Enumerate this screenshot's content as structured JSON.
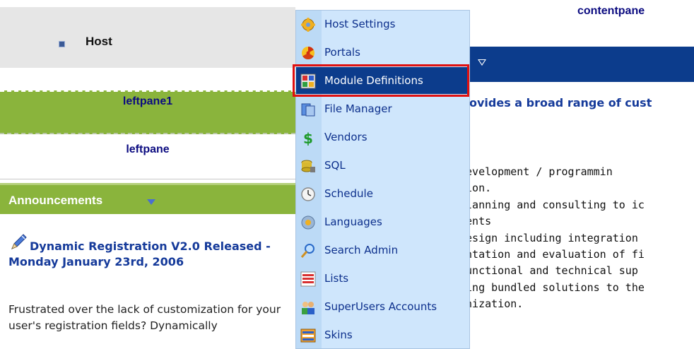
{
  "left": {
    "host_label": "Host",
    "leftpane1_label": "leftpane1",
    "leftpane_label": "leftpane",
    "announcements_title": "Announcements",
    "article_title": "Dynamic Registration V2.0 Released - Monday January 23rd, 2006",
    "article_body": "Frustrated over the lack of customization for your user's registration fields? Dynamically"
  },
  "content": {
    "pane_label": "contentpane",
    "heading": "ovides a broad range of cust",
    "lines": [
      "development / programmin",
      "tion.",
      "planning and consulting to ic",
      "nents",
      " design including integration",
      "entation and evaluation of fi",
      "functional and technical sup",
      "zing bundled solutions to the",
      "anization."
    ]
  },
  "menu": {
    "items": [
      {
        "label": "Host Settings",
        "icon": "host-settings-icon"
      },
      {
        "label": "Portals",
        "icon": "portals-icon"
      },
      {
        "label": "Module Definitions",
        "icon": "module-definitions-icon"
      },
      {
        "label": "File Manager",
        "icon": "file-manager-icon"
      },
      {
        "label": "Vendors",
        "icon": "vendors-icon"
      },
      {
        "label": "SQL",
        "icon": "sql-icon"
      },
      {
        "label": "Schedule",
        "icon": "schedule-icon"
      },
      {
        "label": "Languages",
        "icon": "languages-icon"
      },
      {
        "label": "Search Admin",
        "icon": "search-admin-icon"
      },
      {
        "label": "Lists",
        "icon": "lists-icon"
      },
      {
        "label": "SuperUsers Accounts",
        "icon": "superusers-accounts-icon"
      },
      {
        "label": "Skins",
        "icon": "skins-icon"
      }
    ],
    "selected": "Module Definitions"
  },
  "colors": {
    "accent_green": "#8ab43c",
    "navy_header": "#0c3c8c",
    "menu_background": "#cfe6fc",
    "highlight_outline": "#e01010"
  }
}
